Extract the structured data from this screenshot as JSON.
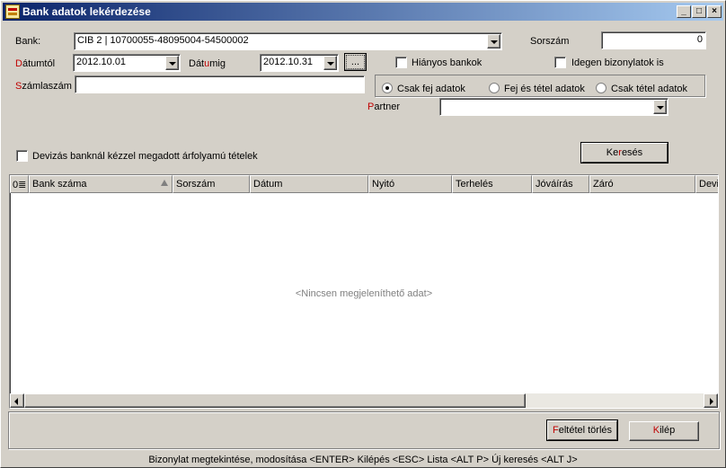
{
  "window": {
    "title": "Bank adatok lekérdezése",
    "minimize": "_",
    "maximize": "□",
    "close": "×"
  },
  "form": {
    "bank_label": "Bank:",
    "bank_value": "CIB 2 | 10700055-48095004-54500002",
    "sorszam_label": "Sorszám",
    "sorszam_value": "0",
    "datumtol_label_acc": "D",
    "datumtol_label_rest": "átumtól",
    "datumtol_value": "2012.10.01",
    "datumig_label_pre": "Dát",
    "datumig_label_acc": "u",
    "datumig_label_rest": "mig",
    "datumig_value": "2012.10.31",
    "dots_label": "...",
    "hianyos_label": "Hiányos bankok",
    "idegen_label": "Idegen bizonylatok is",
    "szamlaszam_label_acc": "S",
    "szamlaszam_label_rest": "zámlaszám",
    "szamlaszam_value": "",
    "radio_fej": "Csak fej adatok",
    "radio_fej_tetel": "Fej és tétel adatok",
    "radio_tetel": "Csak tétel adatok",
    "partner_label_acc": "P",
    "partner_label_rest": "artner",
    "partner_value": "",
    "devizas_label": "Devizás banknál kézzel megadott árfolyamú tételek",
    "kereses_pre": "Ke",
    "kereses_acc": "r",
    "kereses_rest": "esés"
  },
  "grid": {
    "columns": [
      "0",
      "Bank száma",
      "Sorszám",
      "Dátum",
      "Nyitó",
      "Terhelés",
      "Jóváírás",
      "Záró",
      "Devi"
    ],
    "empty_message": "<Nincsen megjeleníthető adat>"
  },
  "footer": {
    "feltetel_acc": "F",
    "feltetel_rest": "eltétel törlés",
    "kilep_acc": "K",
    "kilep_rest": "ilép",
    "status_text": "Bizonylat megtekintése, modosítása <ENTER>   Kilépés <ESC> Lista <ALT P> Új keresés <ALT J>"
  }
}
